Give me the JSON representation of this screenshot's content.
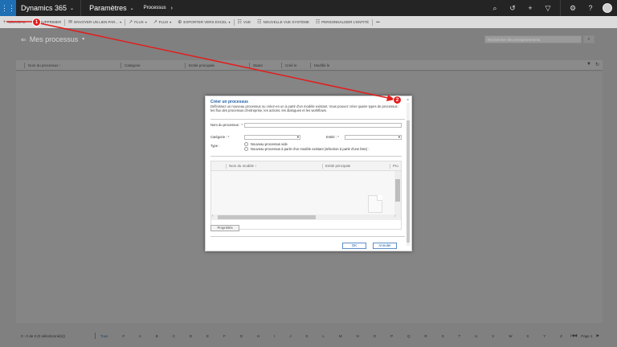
{
  "topbar": {
    "app_title": "Dynamics 365",
    "area": "Paramètres",
    "subarea": "Processus",
    "icons": [
      "search-icon",
      "history-icon",
      "plus-icon",
      "filter-icon",
      "gear-icon",
      "help-icon",
      "avatar"
    ]
  },
  "commands": [
    {
      "icon": "+",
      "label": "NOUVEAU"
    },
    {
      "icon": "🗑",
      "label": "SUPPRIMER"
    },
    {
      "icon": "✉",
      "label": "ENVOYER UN LIEN PAR...",
      "dropdown": true
    },
    {
      "icon": "↗",
      "label": "FLUX",
      "dropdown": true
    },
    {
      "icon": "↗",
      "label": "FLUX",
      "dropdown": true
    },
    {
      "icon": "⊕",
      "label": "EXPORTER VERS EXCEL",
      "dropdown": true
    },
    {
      "icon": "☷",
      "label": "VUE"
    },
    {
      "icon": "☷",
      "label": "NOUVELLE VUE SYSTÈME"
    },
    {
      "icon": "☷",
      "label": "PERSONNALISER L'ENTITÉ"
    },
    {
      "icon": "",
      "label": "•••"
    }
  ],
  "page": {
    "title": "Mes processus",
    "search_placeholder": "Rechercher des enregistrements"
  },
  "grid": {
    "columns": [
      "Nom du processus ↑",
      "Catégorie",
      "Entité principale",
      "Statut",
      "Créé le",
      "Modifié le"
    ]
  },
  "footer": {
    "count": "0 - 0 de 0 (0 sélectionné(s))",
    "letters": [
      "Tous",
      "#",
      "A",
      "B",
      "C",
      "D",
      "E",
      "F",
      "G",
      "H",
      "I",
      "J",
      "K",
      "L",
      "M",
      "N",
      "O",
      "P",
      "Q",
      "R",
      "S",
      "T",
      "U",
      "V",
      "W",
      "X",
      "Y",
      "Z"
    ],
    "page_label": "Page 1"
  },
  "dialog": {
    "title": "Créer un processus",
    "description": "Définissez un nouveau processus ou créez-en un à partir d'un modèle existant. Vous pouvez créer quatre types de processus : les flux des processus d'entreprise, les actions, les dialogues et les workflows.",
    "name_label": "Nom du processus : *",
    "category_label": "Catégorie : *",
    "entity_label": "Entité : *",
    "type_label": "Type :",
    "radio_blank": "Nouveau processus vide",
    "radio_template": "Nouveau processus à partir d'un modèle existant (sélection à partir d'une liste) :",
    "template_columns": [
      "Nom du modèle ↑",
      "Entité principale",
      "Pro"
    ],
    "properties_button": "Propriétés",
    "ok_button": "OK",
    "cancel_button": "Annuler"
  },
  "annotations": {
    "marker1": "1",
    "marker2": "2",
    "arrow_color": "#e21d1d"
  }
}
